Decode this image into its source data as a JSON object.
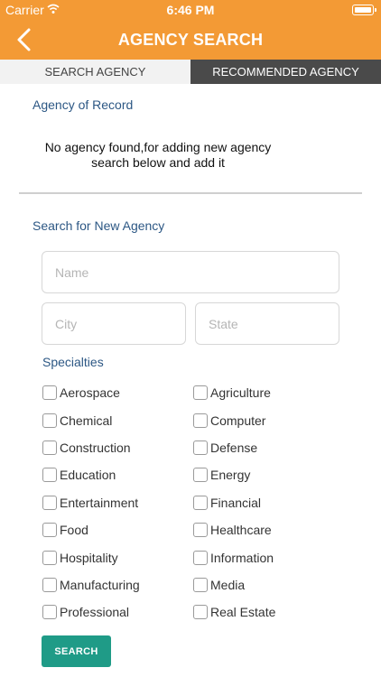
{
  "status_bar": {
    "carrier": "Carrier",
    "time": "6:46 PM"
  },
  "nav": {
    "title": "AGENCY SEARCH"
  },
  "tabs": [
    {
      "label": "SEARCH AGENCY",
      "active": true
    },
    {
      "label": "RECOMMENDED AGENCY",
      "active": false
    }
  ],
  "agency_of_record": {
    "title": "Agency of Record",
    "empty_line1": "No agency found,for adding new agency",
    "empty_line2": "search below and add it"
  },
  "new_agency": {
    "title": "Search for New Agency",
    "name_placeholder": "Name",
    "city_placeholder": "City",
    "state_placeholder": "State"
  },
  "specialties": {
    "label": "Specialties",
    "left": [
      "Aerospace",
      "Chemical",
      "Construction",
      "Education",
      "Entertainment",
      "Food",
      "Hospitality",
      "Manufacturing",
      "Professional"
    ],
    "right": [
      "Agriculture",
      "Computer",
      "Defense",
      "Energy",
      "Financial",
      "Healthcare",
      "Information",
      "Media",
      "Real Estate"
    ]
  },
  "search_button": {
    "label": "SEARCH"
  },
  "colors": {
    "header": "#f39a35",
    "accent_blue": "#2c5784",
    "button": "#1f9b87",
    "tab_inactive": "#4a4a4a"
  }
}
